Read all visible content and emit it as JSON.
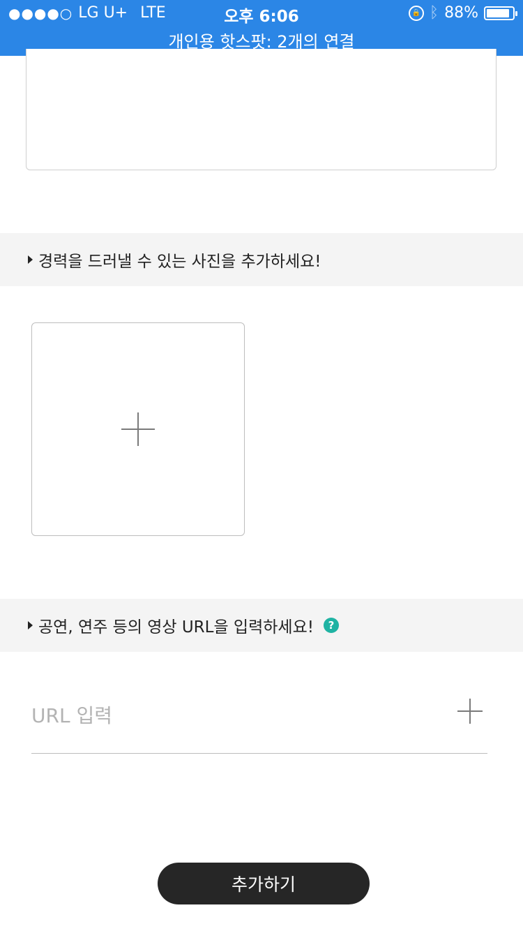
{
  "status_bar": {
    "signal": "●●●●○",
    "carrier": "LG U+",
    "network": "LTE",
    "time": "오후 6:06",
    "battery_percent": "88%",
    "battery_level": 0.88,
    "hotspot": "개인용 핫스팟: 2개의 연결"
  },
  "photo_section": {
    "title": "경력을 드러낼 수 있는 사진을 추가하세요!"
  },
  "video_section": {
    "title": "공연, 연주 등의 영상 URL을 입력하세요!",
    "help": "?"
  },
  "url_input": {
    "placeholder": "URL 입력",
    "value": ""
  },
  "submit": {
    "label": "추가하기"
  },
  "colors": {
    "status_bar": "#2b86e6",
    "help_icon": "#1fb3a3",
    "submit_button": "#262626"
  }
}
